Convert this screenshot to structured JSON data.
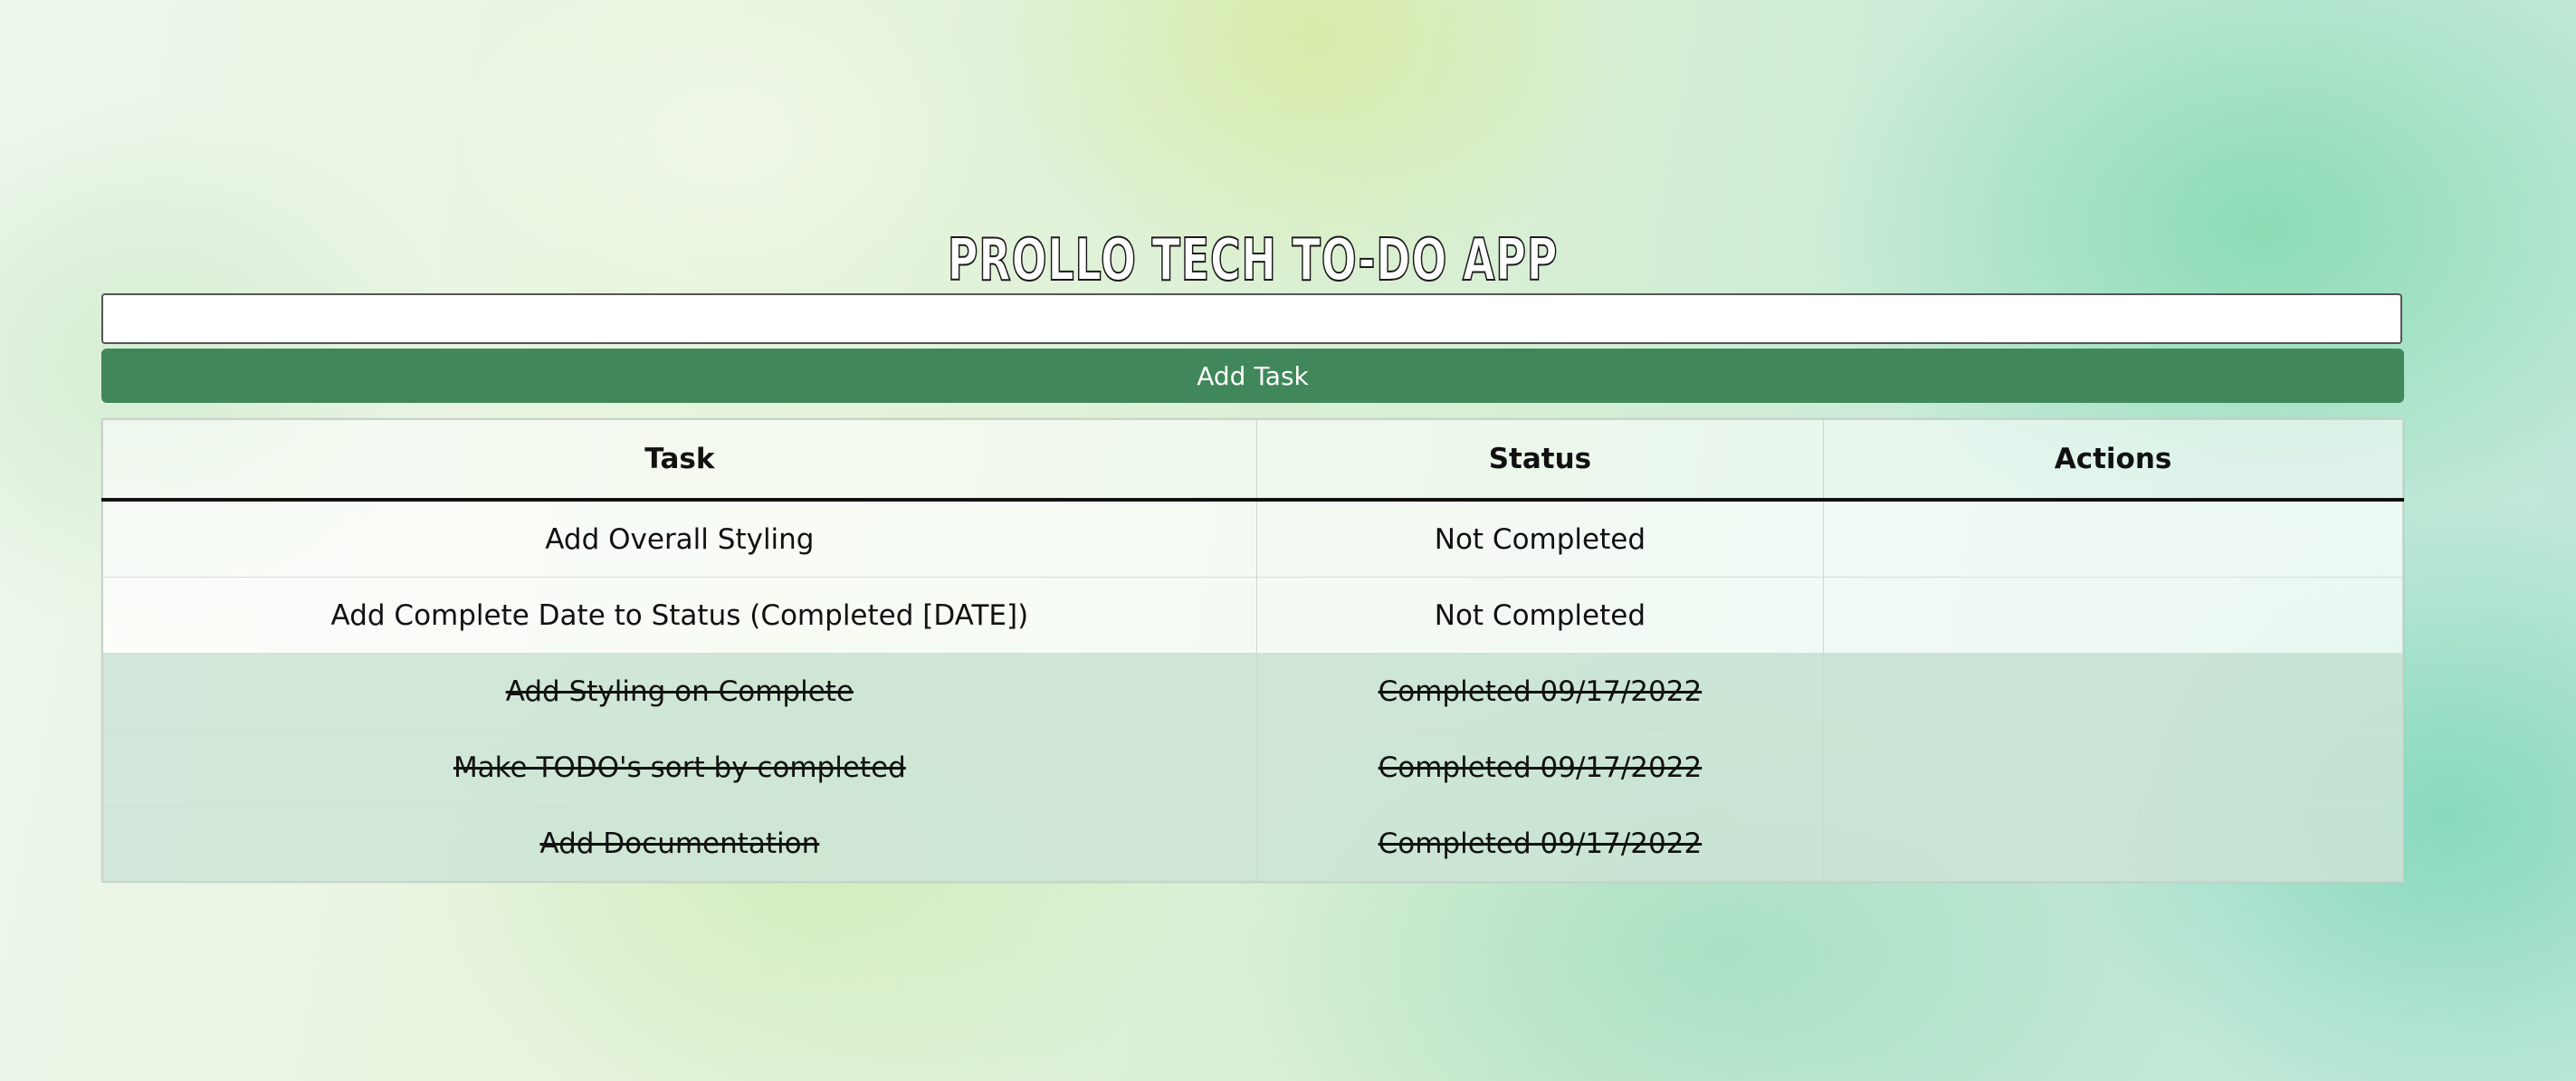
{
  "app": {
    "title": "PROLLO TECH TO-DO APP"
  },
  "form": {
    "input_value": "",
    "add_button_label": "Add Task"
  },
  "table": {
    "headers": {
      "task": "Task",
      "status": "Status",
      "actions": "Actions"
    },
    "rows": [
      {
        "task": "Add Overall Styling",
        "status": "Not Completed",
        "completed": false
      },
      {
        "task": "Add Complete Date to Status (Completed [DATE])",
        "status": "Not Completed",
        "completed": false
      },
      {
        "task": "Add Styling on Complete",
        "status": "Completed 09/17/2022",
        "completed": true
      },
      {
        "task": "Make TODO's sort by completed",
        "status": "Completed 09/17/2022",
        "completed": true
      },
      {
        "task": "Add Documentation",
        "status": "Completed 09/17/2022",
        "completed": true
      }
    ]
  },
  "colors": {
    "accent_green": "#40875a",
    "completed_text": "#3d8a5a",
    "completed_row_bg": "#d3e6d9"
  }
}
